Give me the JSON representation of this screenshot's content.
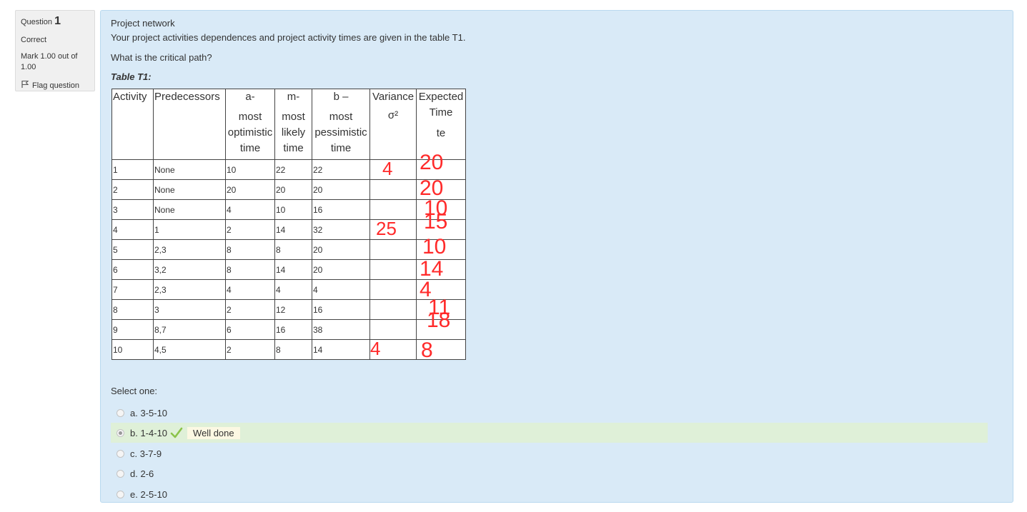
{
  "info": {
    "question_label": "Question",
    "question_number": "1",
    "state": "Correct",
    "grade": "Mark 1.00 out of 1.00",
    "flag_label": "Flag question"
  },
  "question": {
    "title": "Project network",
    "description": "Your project activities dependences and project activity times are given in the table T1.",
    "ask": "What is the critical path?",
    "table_caption": "Table T1:"
  },
  "table": {
    "headers": [
      [
        "Activity"
      ],
      [
        "Predecessors"
      ],
      [
        "a-",
        "most",
        "optimistic",
        "time"
      ],
      [
        "m-",
        "most",
        "likely",
        "time"
      ],
      [
        "b –",
        "most",
        "pessimistic",
        "time"
      ],
      [
        "Variance",
        "σ²"
      ],
      [
        "Expected",
        "Time",
        "te"
      ]
    ],
    "rows": [
      [
        "1",
        "None",
        "10",
        "22",
        "22"
      ],
      [
        "2",
        "None",
        "20",
        "20",
        "20"
      ],
      [
        "3",
        "None",
        "4",
        "10",
        "16"
      ],
      [
        "4",
        "1",
        "2",
        "14",
        "32"
      ],
      [
        "5",
        "2,3",
        "8",
        "8",
        "20"
      ],
      [
        "6",
        "3,2",
        "8",
        "14",
        "20"
      ],
      [
        "7",
        "2,3",
        "4",
        "4",
        "4"
      ],
      [
        "8",
        "3",
        "2",
        "12",
        "16"
      ],
      [
        "9",
        "8,7",
        "6",
        "16",
        "38"
      ],
      [
        "10",
        "4,5",
        "2",
        "8",
        "14"
      ]
    ],
    "handwritten_variance": [
      "4",
      "",
      "",
      "25",
      "",
      "",
      "",
      "",
      "",
      "4"
    ],
    "handwritten_expected": [
      "20",
      "20",
      "10",
      "15",
      "10",
      "14",
      "4",
      "11",
      "18",
      "8"
    ],
    "handwriting_color": "#ff2a2a"
  },
  "answer": {
    "prompt": "Select one:",
    "options": [
      {
        "label": "a. 3-5-10",
        "selected": false
      },
      {
        "label": "b. 1-4-10",
        "selected": true
      },
      {
        "label": "c. 3-7-9",
        "selected": false
      },
      {
        "label": "d. 2-6",
        "selected": false
      },
      {
        "label": "e. 2-5-10",
        "selected": false
      }
    ],
    "feedback": "Well done",
    "correct_color": "#8bc34a",
    "selected_bg": "#dff0d8"
  }
}
